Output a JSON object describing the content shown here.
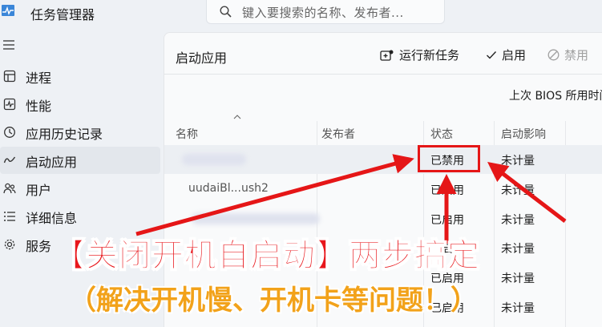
{
  "app": {
    "title": "任务管理器"
  },
  "search": {
    "placeholder": "键入要搜索的名称、发布者..."
  },
  "sidebar": {
    "items": [
      {
        "label": "进程",
        "icon": "processes-icon"
      },
      {
        "label": "性能",
        "icon": "performance-icon"
      },
      {
        "label": "应用历史记录",
        "icon": "app-history-icon"
      },
      {
        "label": "启动应用",
        "icon": "startup-apps-icon",
        "active": true
      },
      {
        "label": "用户",
        "icon": "users-icon"
      },
      {
        "label": "详细信息",
        "icon": "details-icon"
      },
      {
        "label": "服务",
        "icon": "services-icon"
      }
    ]
  },
  "panel": {
    "title": "启动应用",
    "toolbar": {
      "run_new_task": "运行新任务",
      "enable": "启用",
      "disable": "禁用"
    },
    "bios_label": "上次 BIOS 所用时间",
    "columns": {
      "name": "名称",
      "publisher": "发布者",
      "status": "状态",
      "impact": "启动影响"
    },
    "rows": [
      {
        "name": "",
        "status": "已禁用",
        "impact": "未计量"
      },
      {
        "name": "uudaiBl...ush2",
        "status": "已启用",
        "impact": "未计量"
      },
      {
        "name": "",
        "status": "已启用",
        "impact": "未计量"
      },
      {
        "name": "",
        "status": "已启用",
        "impact": "未计量"
      },
      {
        "name": "",
        "status": "已启用",
        "impact": "未计量"
      },
      {
        "name": "",
        "status": "已启用",
        "impact": "未计量"
      }
    ]
  },
  "overlay": {
    "headline": "【关闭开机自启动】两步搞定",
    "subline": "（解决开机慢、开机卡等问题！）",
    "colors": {
      "headline": "#e8171c",
      "subline": "#f2a21a",
      "arrows": "#e51617"
    }
  }
}
